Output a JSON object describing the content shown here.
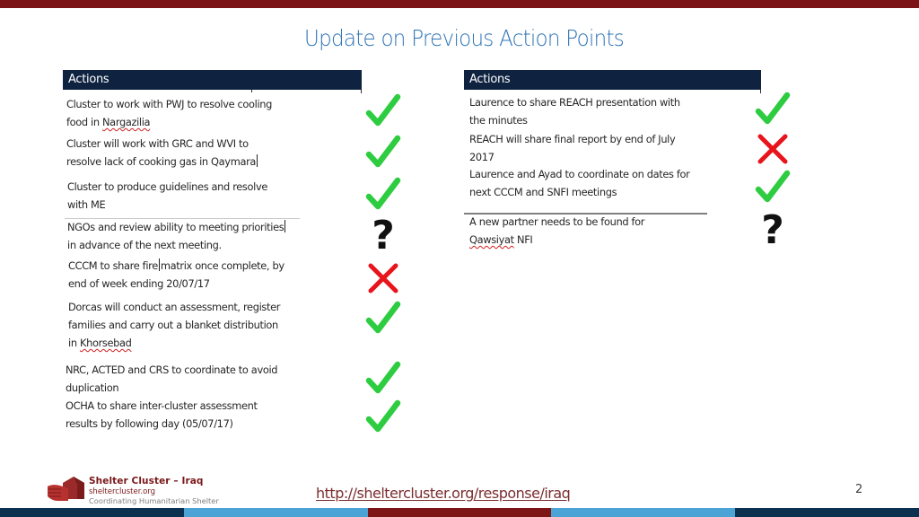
{
  "slide": {
    "title": "Update on Previous Action Points",
    "page_number": "2"
  },
  "colors": {
    "top_bar": "#7b1416",
    "title": "#2e74b5",
    "table_header": "#0f2340",
    "check": "#2ecc40",
    "cross": "#e8141c",
    "question": "#111111",
    "bottom_bar": [
      "#0c3150",
      "#4ba3d6",
      "#7d1416",
      "#4ba3d6",
      "#0c3150"
    ]
  },
  "left_table": {
    "header": "Actions",
    "rows": [
      {
        "lines": [
          "Cluster to work with PWJ to resolve cooling",
          "food in |Nargazilia|"
        ],
        "status": "check"
      },
      {
        "lines": [
          "Cluster will work with GRC and WVI to",
          "resolve lack of cooking gas in Qaymara"
        ],
        "status": "check"
      },
      {
        "lines": [
          "Cluster to produce guidelines and resolve",
          "with ME"
        ],
        "status": "check"
      },
      {
        "lines": [
          "NGOs and review ability to meeting priorities",
          "in advance of the next meeting."
        ],
        "status": "question"
      },
      {
        "lines": [
          "CCCM to share fire matrix once complete, by",
          "end of week ending 20/07/17"
        ],
        "status": "cross"
      },
      {
        "lines": [
          "Dorcas will conduct an assessment, register",
          "families and carry out a blanket distribution",
          "in |Khorsebad|"
        ],
        "status": "check"
      },
      {
        "lines": [
          "NRC, ACTED and CRS to coordinate to avoid",
          "duplication"
        ],
        "status": "check"
      },
      {
        "lines": [
          "OCHA to share inter-cluster assessment",
          "results by following day (05/07/17)"
        ],
        "status": "check"
      }
    ]
  },
  "right_table": {
    "header": "Actions",
    "rows": [
      {
        "lines": [
          "Laurence to share REACH presentation with",
          "the minutes"
        ],
        "status": "check"
      },
      {
        "lines": [
          "REACH will share final report by end of July",
          "2017"
        ],
        "status": "cross"
      },
      {
        "lines": [
          "Laurence and Ayad to coordinate on dates for",
          "next CCCM and SNFI meetings"
        ],
        "status": "check"
      },
      {
        "lines": [
          "A new partner needs to be found for",
          "|Qawsiyat| NFI"
        ],
        "status": "question"
      }
    ]
  },
  "footer": {
    "org_name": "Shelter Cluster – Iraq",
    "org_site": "sheltercluster.org",
    "org_tagline": "Coordinating Humanitarian Shelter",
    "link": "http://sheltercluster.org/response/iraq",
    "logo_icon": "hand-house-logo"
  }
}
